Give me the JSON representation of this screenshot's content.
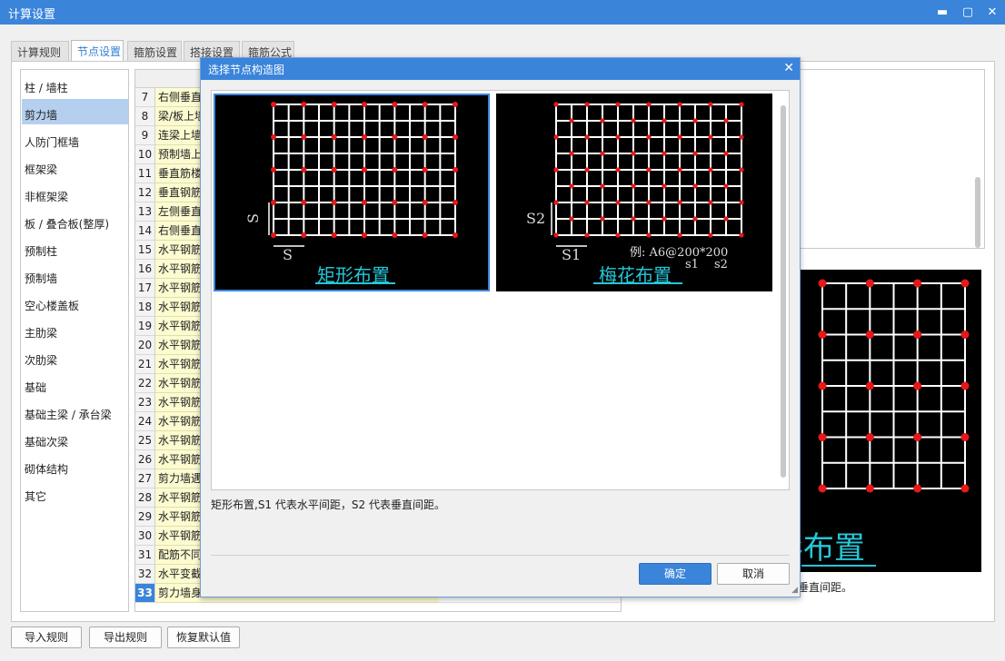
{
  "window": {
    "title": "计算设置",
    "controls": [
      "▬",
      "▢",
      "✕"
    ]
  },
  "tabs": [
    "计算规则",
    "节点设置",
    "箍筋设置",
    "搭接设置",
    "箍筋公式"
  ],
  "sidebar": {
    "selected": 1,
    "items": [
      "柱 / 墙柱",
      "剪力墙",
      "人防门框墙",
      "框架梁",
      "非框架梁",
      "板 / 叠合板(整厚)",
      "预制柱",
      "预制墙",
      "空心楼盖板",
      "主肋梁",
      "次肋梁",
      "基础",
      "基础主梁 / 承台梁",
      "基础次梁",
      "砌体结构",
      "其它"
    ]
  },
  "table": {
    "rows": [
      {
        "n": "7",
        "name": "右侧垂直"
      },
      {
        "n": "8",
        "name": "梁/板上墙"
      },
      {
        "n": "9",
        "name": "连梁上墙"
      },
      {
        "n": "10",
        "name": "预制墙上"
      },
      {
        "n": "11",
        "name": "垂直筋楼"
      },
      {
        "n": "12",
        "name": "垂直钢筋"
      },
      {
        "n": "13",
        "name": "左侧垂直"
      },
      {
        "n": "14",
        "name": "右侧垂直"
      },
      {
        "n": "15",
        "name": "水平钢筋"
      },
      {
        "n": "16",
        "name": "水平钢筋"
      },
      {
        "n": "17",
        "name": "水平钢筋"
      },
      {
        "n": "18",
        "name": "水平钢筋"
      },
      {
        "n": "19",
        "name": "水平钢筋"
      },
      {
        "n": "20",
        "name": "水平钢筋"
      },
      {
        "n": "21",
        "name": "水平钢筋"
      },
      {
        "n": "22",
        "name": "水平钢筋"
      },
      {
        "n": "23",
        "name": "水平钢筋"
      },
      {
        "n": "24",
        "name": "水平钢筋"
      },
      {
        "n": "25",
        "name": "水平钢筋"
      },
      {
        "n": "26",
        "name": "水平钢筋"
      },
      {
        "n": "27",
        "name": "剪力墙遇"
      },
      {
        "n": "28",
        "name": "水平钢筋"
      },
      {
        "n": "29",
        "name": "水平钢筋"
      },
      {
        "n": "30",
        "name": "水平钢筋"
      },
      {
        "n": "31",
        "name": "配筋不同"
      },
      {
        "n": "32",
        "name": "水平变截"
      },
      {
        "n": "33",
        "name": "剪力墙身"
      }
    ],
    "selected_row": "33"
  },
  "preview": {
    "caption": "形布置",
    "desc": "垂直间距。"
  },
  "bottom_buttons": {
    "import": "导入规则",
    "export": "导出规则",
    "restore": "恢复默认值"
  },
  "dialog": {
    "title": "选择节点构造图",
    "close": "✕",
    "options": [
      {
        "caption": "矩形布置",
        "label_s": "S",
        "label_s_bottom": "S"
      },
      {
        "caption": "梅花布置",
        "label_s2": "S2",
        "label_s1": "S1",
        "example": "例: A6@200*200",
        "s1": "s1",
        "s2": "s2"
      }
    ],
    "description": "矩形布置,S1 代表水平间距，S2 代表垂直间距。",
    "ok": "确定",
    "cancel": "取消"
  },
  "colors": {
    "accent": "#3a84da",
    "selection": "#b5d0ee",
    "grid_line": "#ffffff",
    "dot": "#e81818",
    "caption": "#25c6d8",
    "row_yellow": "#fdfbd0"
  }
}
